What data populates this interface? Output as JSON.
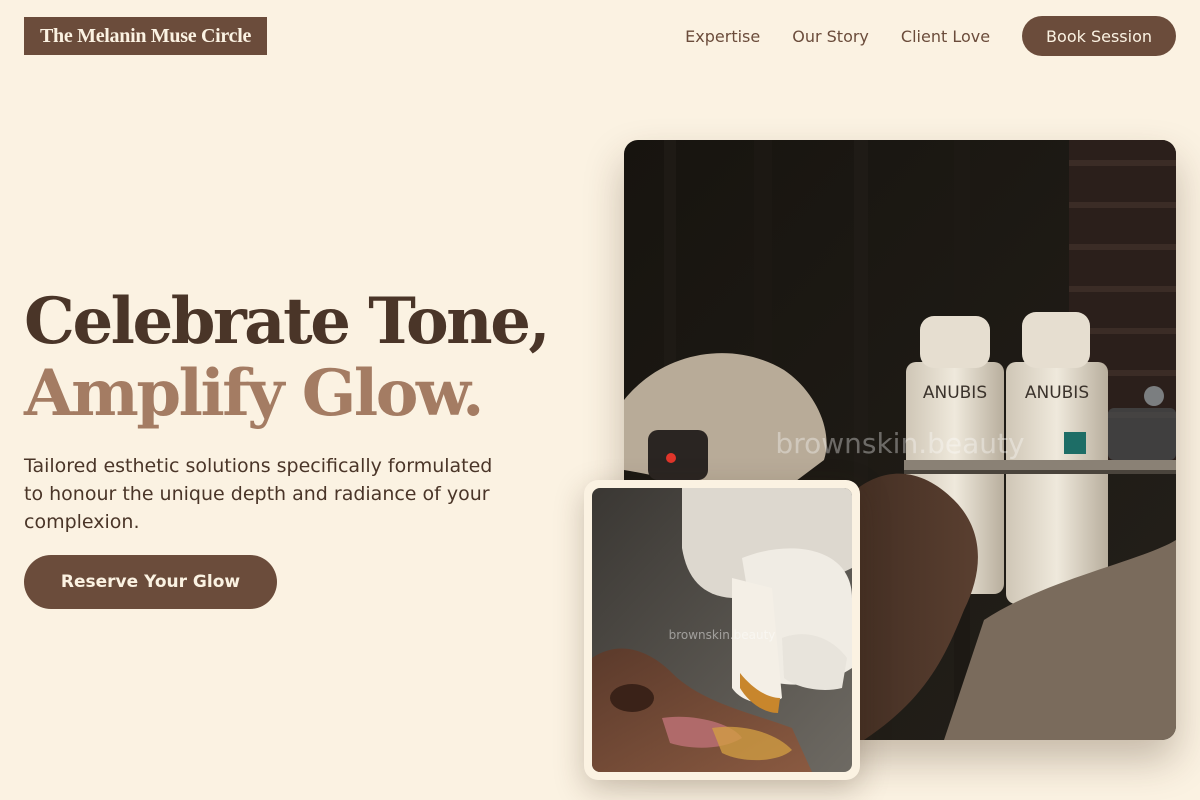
{
  "header": {
    "logo_text": "The Melanin Muse Circle",
    "nav": [
      "Expertise",
      "Our Story",
      "Client Love"
    ],
    "cta_label": "Book Session"
  },
  "hero": {
    "title_line1": "Celebrate Tone,",
    "title_line2": "Amplify Glow.",
    "subtitle": "Tailored esthetic solutions specifically formulated to honour the unique depth and radiance of your complexion.",
    "cta_label": "Reserve Your Glow"
  },
  "images": {
    "main_watermark": "brownskin.beauty",
    "bottle_brand": "ANUBIS",
    "inset_watermark": "brownskin.beauty"
  },
  "colors": {
    "background": "#fbf2e2",
    "accent_brown": "#6b4c3b",
    "heading_dark": "#4a3528",
    "heading_light": "#a47c63"
  }
}
